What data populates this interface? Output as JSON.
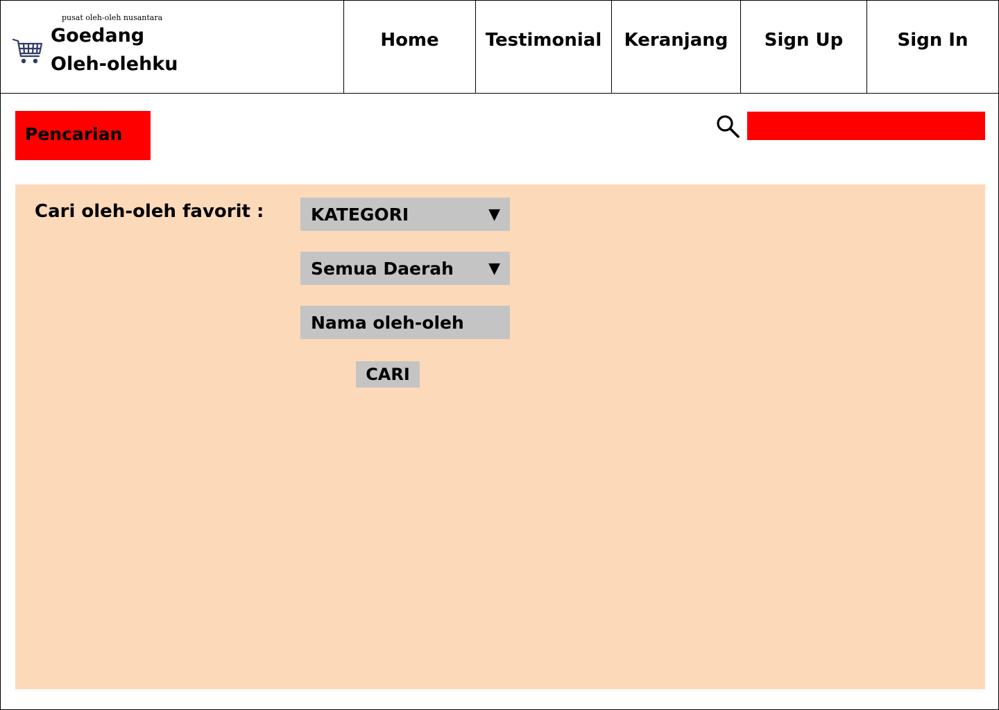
{
  "header": {
    "tagline": "pusat oleh-oleh nusantara",
    "brand_line1": "Goedang",
    "brand_line2": "Oleh-olehku",
    "logo_icon": "shopping-cart-icon",
    "nav": {
      "home": "Home",
      "testimonial": "Testimonial",
      "keranjang": "Keranjang",
      "signup": "Sign Up",
      "signin": "Sign In"
    }
  },
  "search_bar": {
    "title": "Pencarian",
    "icon": "search-icon",
    "input_value": ""
  },
  "filter_panel": {
    "label": "Cari oleh-oleh favorit :",
    "category_select": "KATEGORI",
    "region_select": "Semua Daerah",
    "name_field": "Nama oleh-oleh",
    "dropdown_arrow": "▼",
    "submit_label": "CARI"
  },
  "colors": {
    "accent_red": "#ff0000",
    "panel_background": "#fcd9b8",
    "control_gray": "#c4c4c4",
    "icon_navy": "#2f3b66"
  }
}
